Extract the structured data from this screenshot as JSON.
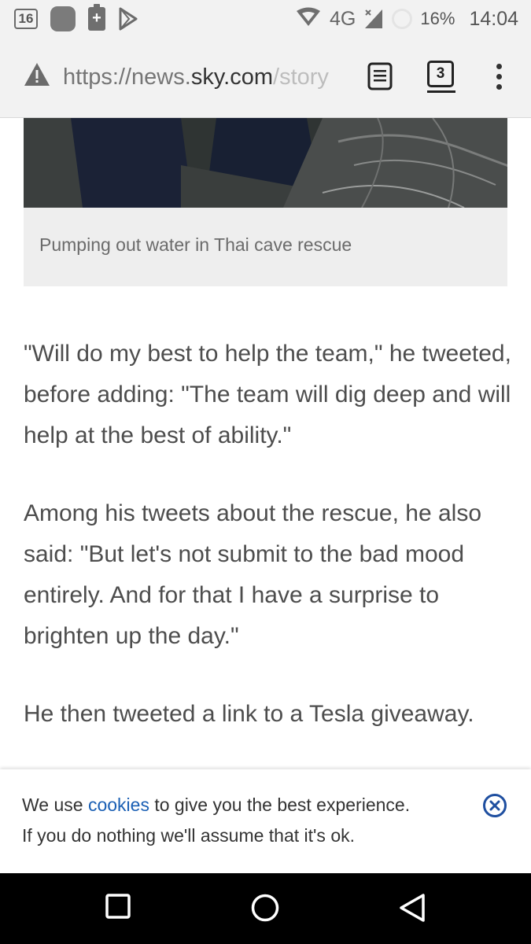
{
  "status_bar": {
    "notification_badge": "16",
    "network": "4G",
    "battery_percent": "16%",
    "time": "14:04"
  },
  "browser": {
    "url_prefix": "https://news.",
    "url_domain": "sky.com",
    "url_path": "/story",
    "tab_count": "3"
  },
  "article": {
    "caption": "Pumping out water in Thai cave rescue",
    "paragraphs": [
      "\"Will do my best to help the team,\" he tweeted, before adding: \"The team will dig deep and will help at the best of ability.\"",
      "Among his tweets about the rescue, he also said: \"But let's not submit to the bad mood entirely. And for that I have a surprise to brighten up the day.\"",
      "He then tweeted a link to a Tesla giveaway."
    ]
  },
  "cookie_banner": {
    "line1_before": "We use ",
    "line1_link": "cookies",
    "line1_after": " to give you the best experience.",
    "line2": "If you do nothing we'll assume that it's ok."
  },
  "colors": {
    "link": "#1a5fb4",
    "text": "#4d4d4d",
    "caption_bg": "#eeeeee"
  }
}
